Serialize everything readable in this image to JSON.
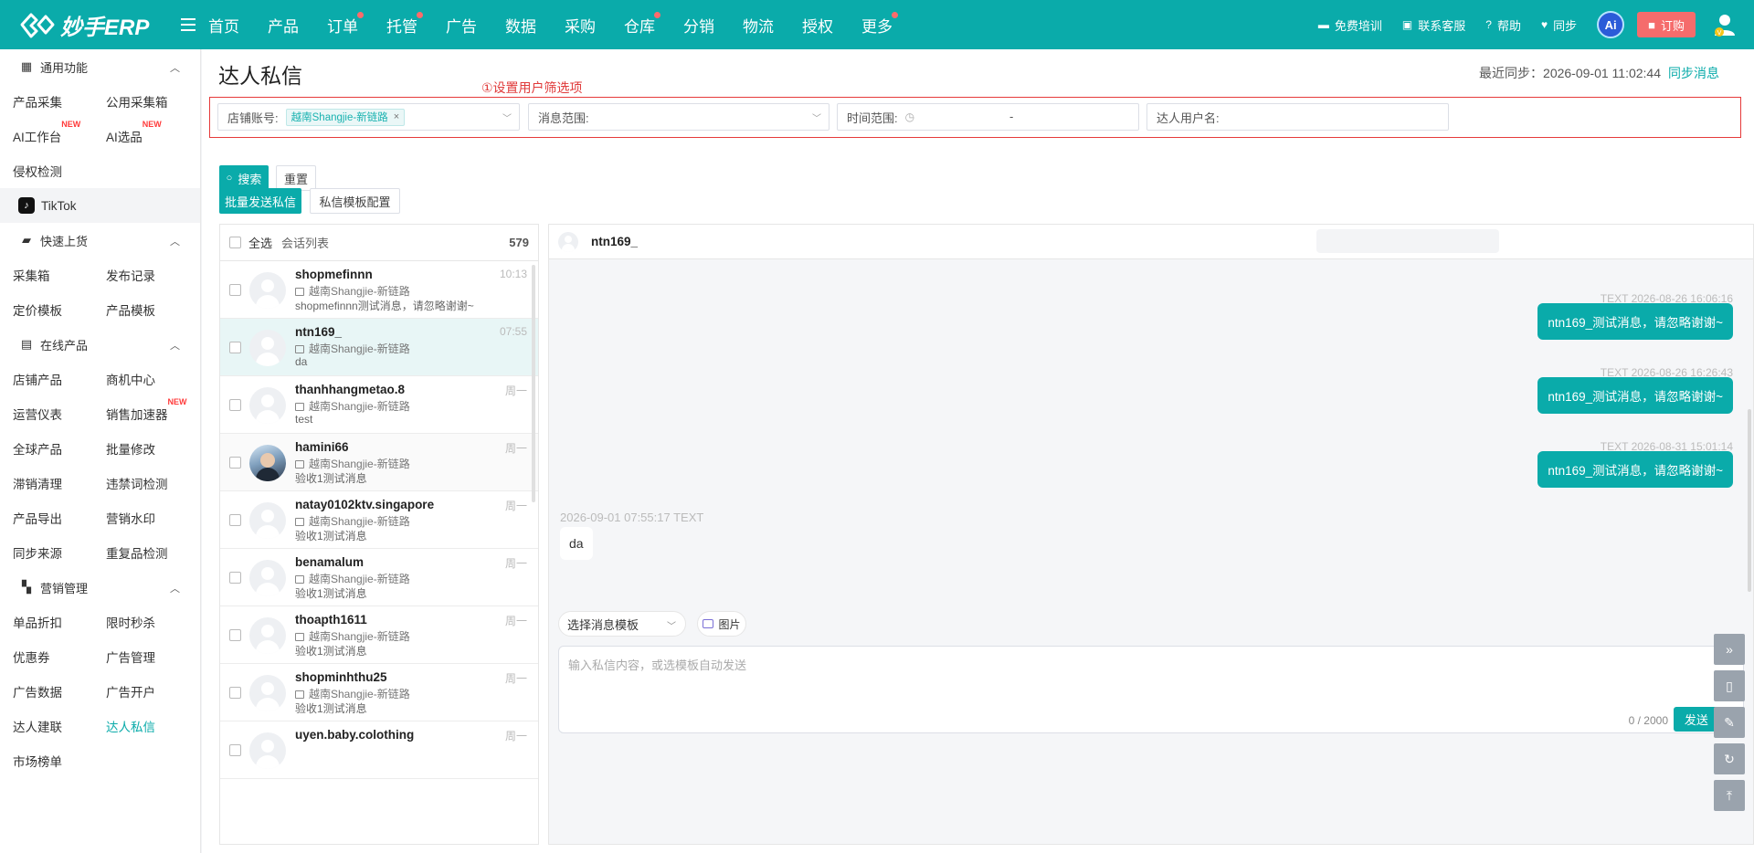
{
  "app": {
    "logo_text": "妙手ERP"
  },
  "topnav": {
    "items": [
      {
        "label": "首页",
        "dot": false
      },
      {
        "label": "产品",
        "dot": false
      },
      {
        "label": "订单",
        "dot": true
      },
      {
        "label": "托管",
        "dot": true
      },
      {
        "label": "广告",
        "dot": false
      },
      {
        "label": "数据",
        "dot": false
      },
      {
        "label": "采购",
        "dot": false
      },
      {
        "label": "仓库",
        "dot": true
      },
      {
        "label": "分销",
        "dot": false
      },
      {
        "label": "物流",
        "dot": false
      },
      {
        "label": "授权",
        "dot": false
      },
      {
        "label": "更多",
        "dot": true
      }
    ],
    "right": {
      "training": "免费培训",
      "support": "联系客服",
      "help": "帮助",
      "sync": "同步",
      "ai": "Ai",
      "order": "订购"
    }
  },
  "sidebar": {
    "groups": [
      {
        "title": "通用功能",
        "rows": [
          [
            "产品采集",
            "公用采集箱"
          ],
          [
            "AI工作台",
            "AI选品"
          ],
          [
            "侵权检测",
            ""
          ]
        ]
      },
      {
        "title": "快速上货",
        "rows": [
          [
            "采集箱",
            "发布记录"
          ],
          [
            "定价模板",
            "产品模板"
          ]
        ]
      },
      {
        "title": "在线产品",
        "rows": [
          [
            "店铺产品",
            "商机中心"
          ],
          [
            "运营仪表",
            "销售加速器"
          ],
          [
            "全球产品",
            "批量修改"
          ],
          [
            "滞销清理",
            "违禁词检测"
          ],
          [
            "产品导出",
            "营销水印"
          ],
          [
            "同步来源",
            "重复品检测"
          ]
        ]
      },
      {
        "title": "营销管理",
        "rows": [
          [
            "单品折扣",
            "限时秒杀"
          ],
          [
            "优惠券",
            "广告管理"
          ],
          [
            "广告数据",
            "广告开户"
          ],
          [
            "达人建联",
            "达人私信"
          ],
          [
            "市场榜单",
            ""
          ]
        ]
      }
    ],
    "platform": "TikTok",
    "new_badge": "NEW"
  },
  "page": {
    "title": "达人私信",
    "sync_label": "最近同步：2026-09-01 11:02:44",
    "sync_link": "同步消息",
    "annotation": "①设置用户筛选项"
  },
  "filters": {
    "shop_label": "店铺账号:",
    "shop_tag": "越南Shangjie-新链路",
    "scope_label": "消息范围:",
    "time_label": "时间范围:",
    "time_sep": "-",
    "user_label": "达人用户名:"
  },
  "actions": {
    "search": "搜索",
    "reset": "重置",
    "bulk_send": "批量发送私信",
    "template_config": "私信模板配置"
  },
  "conversations": {
    "select_all": "全选",
    "list_title": "会话列表",
    "count": "579",
    "items": [
      {
        "name": "shopmefinnn",
        "shop": "越南Shangjie-新链路",
        "msg": "shopmefinnn测试消息，请忽略谢谢~",
        "time": "10:13",
        "selected": false,
        "photo": false
      },
      {
        "name": "ntn169_",
        "shop": "越南Shangjie-新链路",
        "msg": "da",
        "time": "07:55",
        "selected": true,
        "photo": false
      },
      {
        "name": "thanhhangmetao.8",
        "shop": "越南Shangjie-新链路",
        "msg": "test",
        "time": "周一",
        "selected": false,
        "photo": false
      },
      {
        "name": "hamini66",
        "shop": "越南Shangjie-新链路",
        "msg": "验收1测试消息",
        "time": "周一",
        "selected": false,
        "photo": true
      },
      {
        "name": "natay0102ktv.singapore",
        "shop": "越南Shangjie-新链路",
        "msg": "验收1测试消息",
        "time": "周一",
        "selected": false,
        "photo": false
      },
      {
        "name": "benamalum",
        "shop": "越南Shangjie-新链路",
        "msg": "验收1测试消息",
        "time": "周一",
        "selected": false,
        "photo": false
      },
      {
        "name": "thoapth1611",
        "shop": "越南Shangjie-新链路",
        "msg": "验收1测试消息",
        "time": "周一",
        "selected": false,
        "photo": false
      },
      {
        "name": "shopminhthu25",
        "shop": "越南Shangjie-新链路",
        "msg": "验收1测试消息",
        "time": "周一",
        "selected": false,
        "photo": false
      },
      {
        "name": "uyen.baby.colothing",
        "shop": "",
        "msg": "",
        "time": "周一",
        "selected": false,
        "photo": false
      }
    ]
  },
  "chat": {
    "contact": "ntn169_",
    "messages": [
      {
        "dir": "out",
        "meta": "TEXT 2026-08-26 16:06:16",
        "text": "ntn169_测试消息，请忽略谢谢~"
      },
      {
        "dir": "out",
        "meta": "TEXT 2026-08-26 16:26:43",
        "text": "ntn169_测试消息，请忽略谢谢~"
      },
      {
        "dir": "out",
        "meta": "TEXT 2026-08-31 15:01:14",
        "text": "ntn169_测试消息，请忽略谢谢~"
      },
      {
        "dir": "in",
        "meta": "2026-09-01 07:55:17 TEXT",
        "text": "da"
      }
    ],
    "template_select": "选择消息模板",
    "image_btn": "图片",
    "input_placeholder": "输入私信内容，或选模板自动发送",
    "counter": "0 / 2000",
    "send": "发送"
  },
  "colors": {
    "brand": "#0aabaa",
    "annotation": "#e63a3a",
    "order": "#f56c6c",
    "new": "#ff3b3b"
  }
}
